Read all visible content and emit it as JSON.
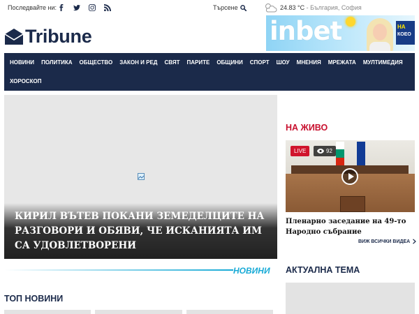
{
  "topbar": {
    "follow_label": "Последвайте ни:",
    "social": [
      "facebook-icon",
      "twitter-icon",
      "instagram-icon",
      "rss-icon"
    ],
    "search_label": "Търсене",
    "weather": {
      "temp": "24.83 °C",
      "location": "- България, София"
    }
  },
  "logo": {
    "text": "Tribune"
  },
  "banner": {
    "brand": "inbet",
    "tag_line1": "НА",
    "tag_line2": "КОЕО"
  },
  "nav": {
    "row1": [
      "НОВИНИ",
      "ПОЛИТИКА",
      "ОБЩЕСТВО",
      "ЗАКОН И РЕД",
      "СВЯТ",
      "ПАРИТЕ",
      "ОБЩИНИ",
      "СПОРТ",
      "ШОУ",
      "МНЕНИЯ",
      "МРЕЖАТА",
      "МУЛТИМЕДИЯ"
    ],
    "row2": [
      "ХОРОСКОП"
    ]
  },
  "hero": {
    "title": "Кирил Вътев покани земеделците на разговори и обяви, че исканията им са удовлетворени"
  },
  "sections": {
    "news_label": "НОВИНИ",
    "top_news": "ТОП НОВИНИ",
    "topic": "АКТУАЛНА ТЕМА"
  },
  "live": {
    "title": "НА ЖИВО",
    "badge": "LIVE",
    "views": "92",
    "caption": "Пленарно заседание на 49-то Народно събрание",
    "all_videos": "ВИЖ ВСИЧКИ ВИДЕА"
  },
  "colors": {
    "navy": "#1b2a4a",
    "accent": "#17aad6",
    "live_red": "#c8102e"
  }
}
